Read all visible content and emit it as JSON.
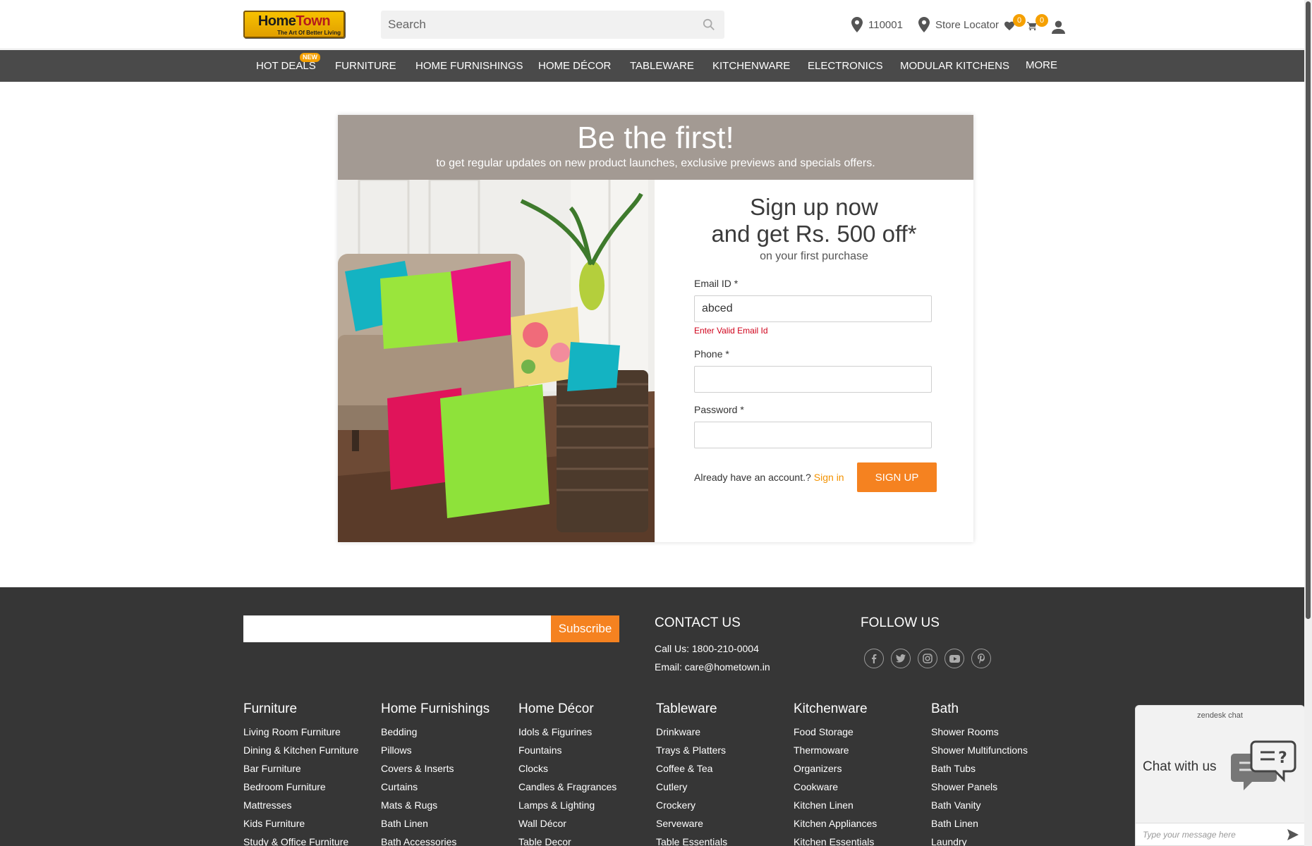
{
  "header": {
    "logo_name_a": "Home",
    "logo_name_b": "Town",
    "logo_tagline": "The Art Of Better Living",
    "search_placeholder": "Search",
    "pincode": "110001",
    "store_locator": "Store Locator",
    "wishlist_count": "0",
    "cart_count": "0"
  },
  "nav": {
    "new_badge": "NEW",
    "items": [
      "HOT DEALS",
      "FURNITURE",
      "HOME FURNISHINGS",
      "HOME DÉCOR",
      "TABLEWARE",
      "KITCHENWARE",
      "ELECTRONICS",
      "MODULAR KITCHENS",
      "MORE"
    ]
  },
  "promo": {
    "title": "Be the first!",
    "subtitle": "to get regular updates on new product launches, exclusive previews and specials offers.",
    "heading_line1": "Sign up now",
    "heading_line2": "and get Rs. 500 off*",
    "heading_sub": "on your first purchase",
    "email_label": "Email ID *",
    "email_value": "abced",
    "email_error": "Enter Valid Email Id",
    "phone_label": "Phone *",
    "phone_value": "",
    "password_label": "Password *",
    "password_value": "",
    "already_text": "Already have an account.?",
    "signin_link": "Sign in",
    "signup_button": "SIGN UP"
  },
  "footer": {
    "subscribe_button": "Subscribe",
    "contact_title": "CONTACT US",
    "call": "Call Us: 1800-210-0004",
    "email": "Email: care@hometown.in",
    "follow_title": "FOLLOW US",
    "columns": [
      {
        "title": "Furniture",
        "links": [
          "Living Room Furniture",
          "Dining & Kitchen Furniture",
          "Bar Furniture",
          "Bedroom Furniture",
          "Mattresses",
          "Kids Furniture",
          "Study & Office Furniture"
        ]
      },
      {
        "title": "Home Furnishings",
        "links": [
          "Bedding",
          "Pillows",
          "Covers & Inserts",
          "Curtains",
          "Mats & Rugs",
          "Bath Linen",
          "Bath Accessories"
        ]
      },
      {
        "title": "Home Décor",
        "links": [
          "Idols & Figurines",
          "Fountains",
          "Clocks",
          "Candles & Fragrances",
          "Lamps & Lighting",
          "Wall Décor",
          "Table Decor"
        ]
      },
      {
        "title": "Tableware",
        "links": [
          "Drinkware",
          "Trays & Platters",
          "Coffee & Tea",
          "Cutlery",
          "Crockery",
          "Serveware",
          "Table Essentials"
        ]
      },
      {
        "title": "Kitchenware",
        "links": [
          "Food Storage",
          "Thermoware",
          "Organizers",
          "Cookware",
          "Kitchen Linen",
          "Kitchen Appliances",
          "Kitchen Essentials"
        ]
      },
      {
        "title": "Bath",
        "links": [
          "Shower Rooms",
          "Shower Multifunctions",
          "Bath Tubs",
          "Shower Panels",
          "Bath Vanity",
          "Bath Linen",
          "Laundry"
        ]
      }
    ]
  },
  "chat": {
    "brand": "zendesk chat",
    "label": "Chat with us",
    "placeholder": "Type your message here"
  },
  "colors": {
    "accent": "#f58220",
    "nav_bg": "#4a4a4a",
    "promo_header_bg": "#a39a93",
    "footer_bg": "#363636",
    "error": "#d0021b"
  }
}
